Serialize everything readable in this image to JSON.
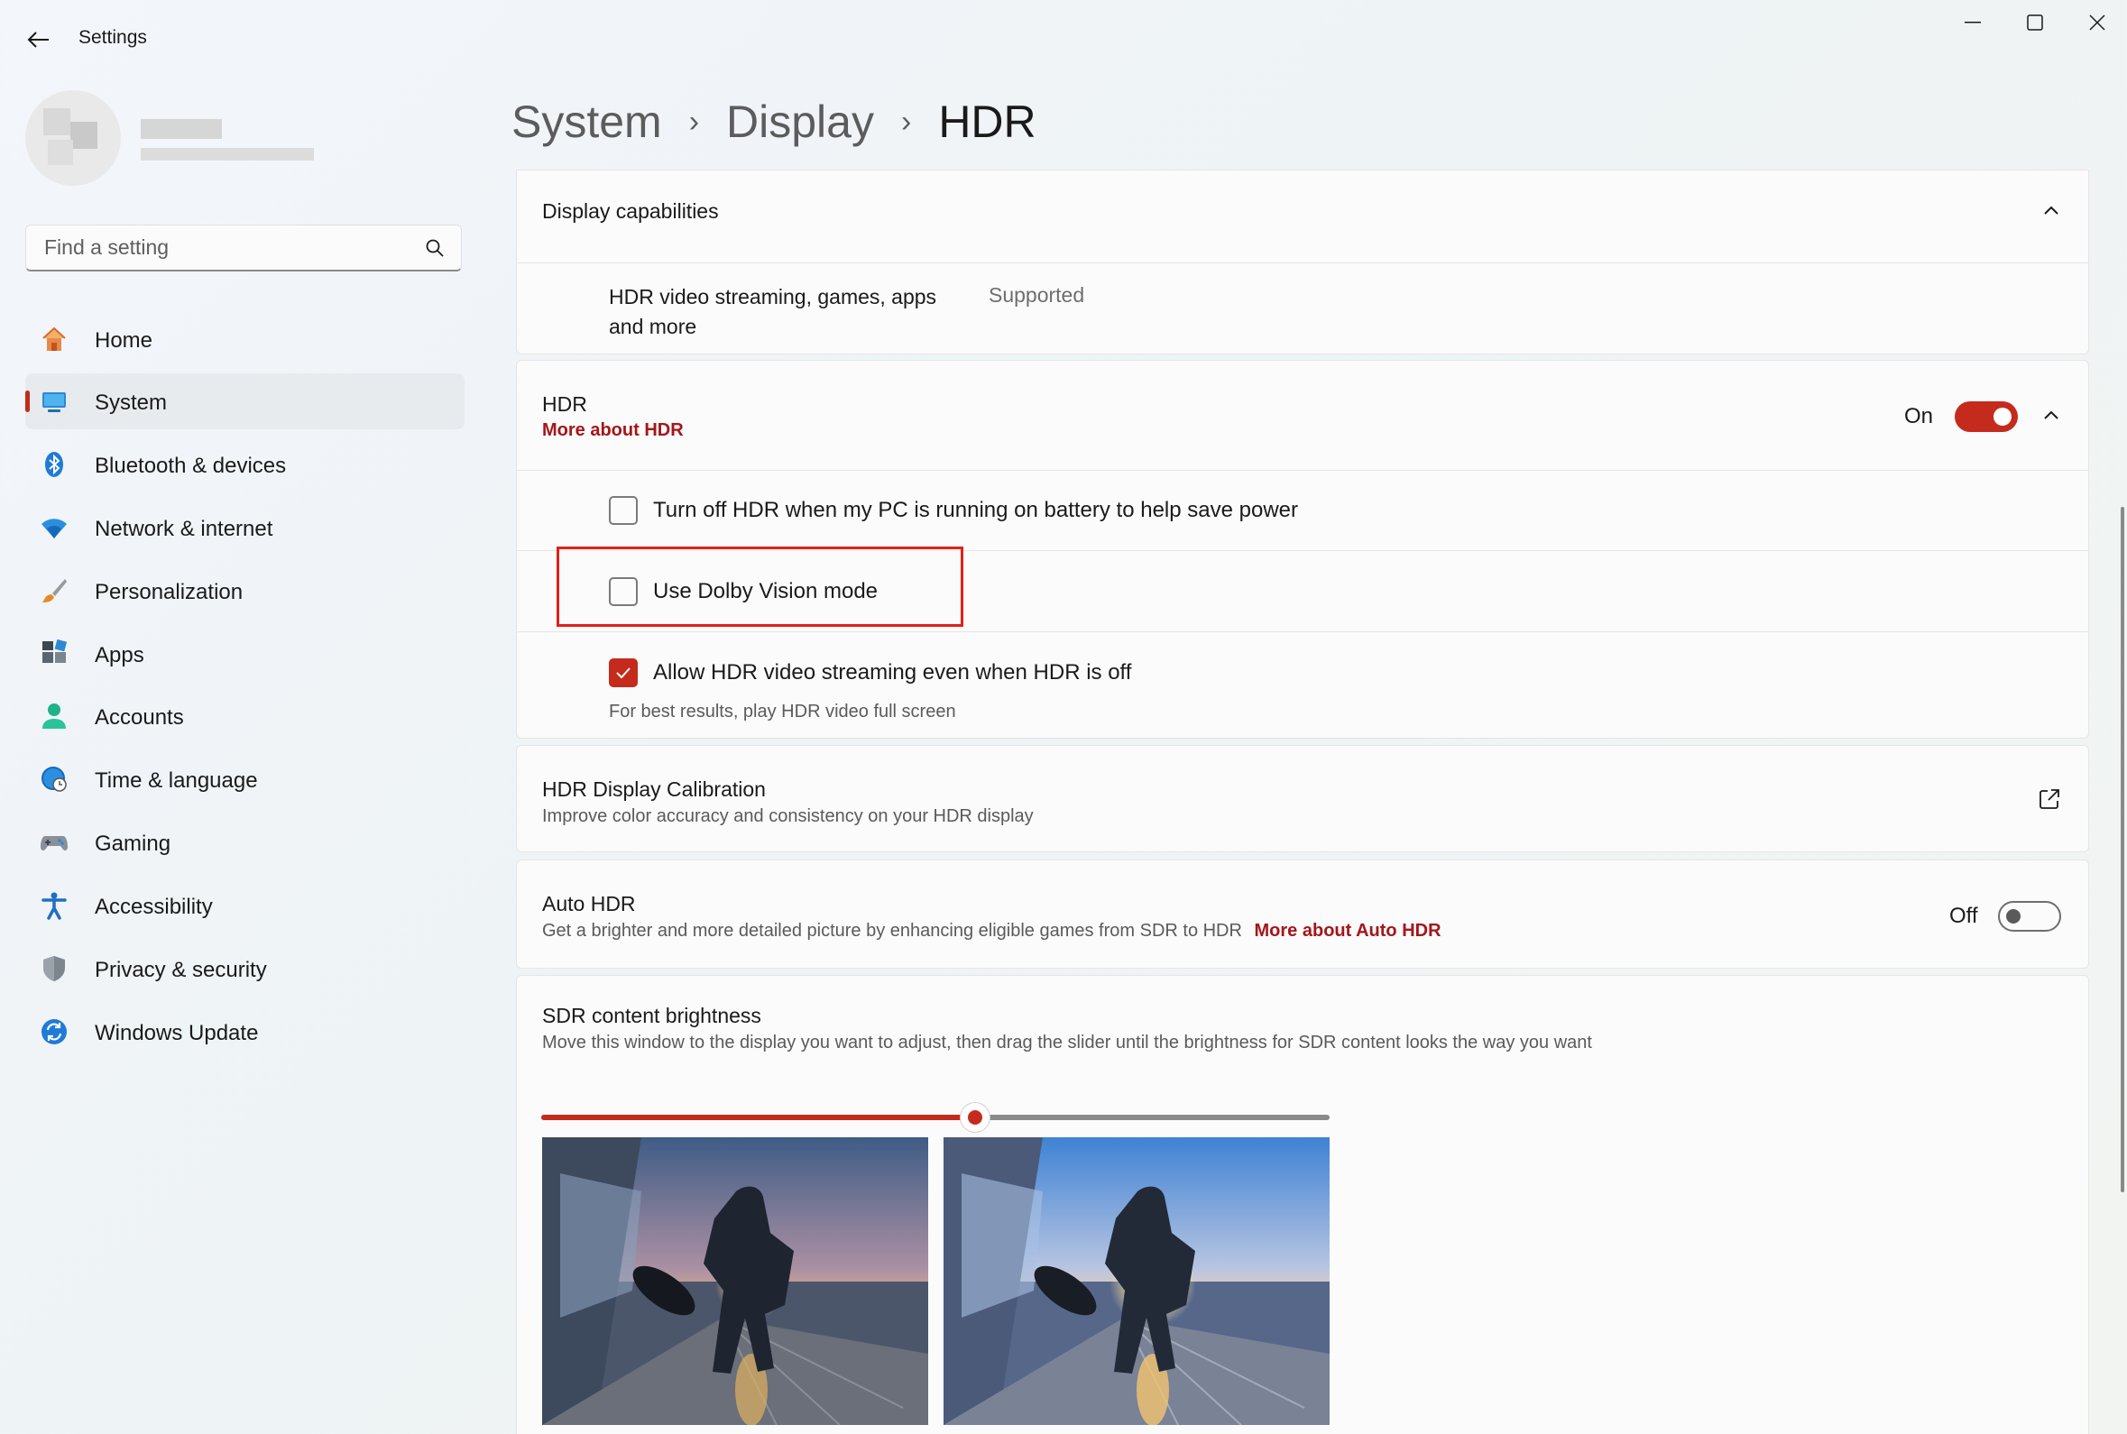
{
  "window": {
    "title": "Settings",
    "controls": [
      "minimize",
      "maximize",
      "close"
    ]
  },
  "search": {
    "placeholder": "Find a setting"
  },
  "sidebar": {
    "items": [
      {
        "label": "Home",
        "icon": "home-icon"
      },
      {
        "label": "System",
        "icon": "system-icon",
        "active": true
      },
      {
        "label": "Bluetooth & devices",
        "icon": "bluetooth-icon"
      },
      {
        "label": "Network & internet",
        "icon": "wifi-icon"
      },
      {
        "label": "Personalization",
        "icon": "brush-icon"
      },
      {
        "label": "Apps",
        "icon": "apps-icon"
      },
      {
        "label": "Accounts",
        "icon": "accounts-icon"
      },
      {
        "label": "Time & language",
        "icon": "time-language-icon"
      },
      {
        "label": "Gaming",
        "icon": "gaming-icon"
      },
      {
        "label": "Accessibility",
        "icon": "accessibility-icon"
      },
      {
        "label": "Privacy & security",
        "icon": "shield-icon"
      },
      {
        "label": "Windows Update",
        "icon": "update-icon"
      }
    ]
  },
  "breadcrumb": {
    "items": [
      "System",
      "Display"
    ],
    "current": "HDR"
  },
  "capabilities": {
    "title": "Display capabilities",
    "row_label_line1": "HDR video streaming, games, apps",
    "row_label_line2": "and more",
    "row_value": "Supported"
  },
  "hdr": {
    "title": "HDR",
    "link": "More about HDR",
    "state_label": "On",
    "enabled": true,
    "options": {
      "battery": {
        "label": "Turn off HDR when my PC is running on battery to help save power",
        "checked": false
      },
      "dolby": {
        "label": "Use Dolby Vision mode",
        "checked": false
      },
      "streaming": {
        "label": "Allow HDR video streaming even when HDR is off",
        "checked": true,
        "hint": "For best results, play HDR video full screen"
      }
    }
  },
  "calibration": {
    "title": "HDR Display Calibration",
    "subtitle": "Improve color accuracy and consistency on your HDR display"
  },
  "auto_hdr": {
    "title": "Auto HDR",
    "subtitle": "Get a brighter and more detailed picture by enhancing eligible games from SDR to HDR",
    "link": "More about Auto HDR",
    "state_label": "Off",
    "enabled": false
  },
  "sdr": {
    "title": "SDR content brightness",
    "subtitle": "Move this window to the display you want to adjust, then drag the slider until the brightness for SDR content looks the way you want",
    "slider_value": 0.55
  },
  "colors": {
    "accent": "#c42b1c",
    "link": "#a4161a",
    "highlight": "#e0201a"
  }
}
